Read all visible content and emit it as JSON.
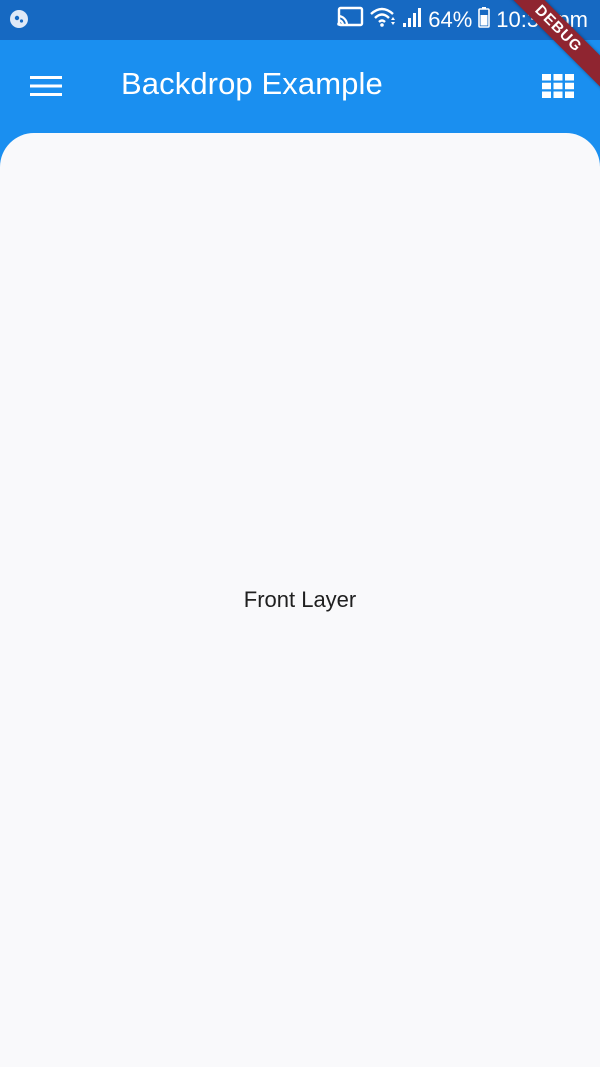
{
  "status_bar": {
    "battery_percent": "64%",
    "time": "10:33 pm",
    "icons": [
      "app-notification-icon",
      "cast-icon",
      "wifi-icon",
      "signal-icon",
      "battery-icon"
    ]
  },
  "debug_banner": {
    "label": "DEBUG"
  },
  "app_bar": {
    "title": "Backdrop Example",
    "leading_icon": "menu-icon",
    "trailing_icon": "grid-view-icon"
  },
  "front_layer": {
    "label": "Front Layer"
  },
  "colors": {
    "app_bar": "#1a8ff0",
    "status_bar": "#1669c2",
    "front_layer": "#f9f9fb",
    "debug_banner": "#8f2530"
  }
}
